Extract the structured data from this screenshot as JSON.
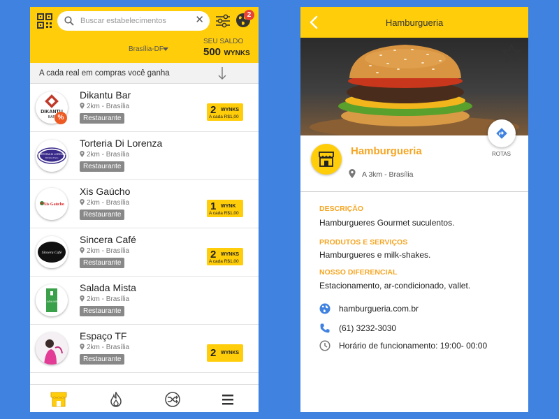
{
  "colors": {
    "background": "#3f82e0",
    "accent": "#ffcd0a",
    "highlight_text": "#f5a623",
    "badge": "#e84135",
    "category_tag": "#888888"
  },
  "list_screen": {
    "search": {
      "placeholder": "Buscar estabelecimentos",
      "clear_icon": "close-icon"
    },
    "notifications_count": "2",
    "region": "Brasília-DF",
    "saldo": {
      "label": "SEU SALDO",
      "value": "500",
      "unit": "WYNKS"
    },
    "info_text": "A cada real em compras você ganha",
    "establishments": [
      {
        "name": "Dikantu Bar",
        "distance": "2km - Brasília",
        "category": "Restaurante",
        "promo": "%",
        "wynks": "2",
        "wynks_unit": "WYNKS",
        "wynks_sub": "A cada R$1,00"
      },
      {
        "name": "Torteria Di Lorenza",
        "distance": "2km - Brasília",
        "category": "Restaurante"
      },
      {
        "name": "Xis Gaúcho",
        "distance": "2km - Brasília",
        "category": "Restaurante",
        "wynks": "1",
        "wynks_unit": "WYNK",
        "wynks_sub": "A cada R$1,00"
      },
      {
        "name": "Sincera Café",
        "distance": "2km - Brasília",
        "category": "Restaurante",
        "wynks": "2",
        "wynks_unit": "WYNKS",
        "wynks_sub": "A cada R$1,00"
      },
      {
        "name": "Salada Mista",
        "distance": "2km - Brasília",
        "category": "Restaurante"
      },
      {
        "name": "Espaço TF",
        "distance": "2km - Brasília",
        "category": "Restaurante",
        "wynks": "2",
        "wynks_unit": "WYNKS"
      }
    ],
    "logo_texts": {
      "dikantu": "DIKANTU",
      "dikantu_sub": "BAR",
      "torteria": "TORTERIA DI LORENZA",
      "torteria_sub": "Di Dolce Forno",
      "xis": "Xis Gaúcho",
      "sincera": "Sincera Café",
      "salada": "SALADA MISTA"
    },
    "nav": [
      "store-icon",
      "flame-icon",
      "shuffle-icon",
      "menu-icon"
    ]
  },
  "detail_screen": {
    "title": "Hamburgueria",
    "name": "Hamburgueria",
    "location": "A 3km - Brasília",
    "route_label": "ROTAS",
    "sections": [
      {
        "heading": "DESCRIÇÃO",
        "text": "Hamburgueres Gourmet suculentos."
      },
      {
        "heading": "PRODUTOS E SERVIÇOS",
        "text": "Hamburgueres e milk-shakes."
      },
      {
        "heading": "NOSSO DIFERENCIAL",
        "text": "Estacionamento, ar-condicionado, vallet."
      }
    ],
    "contacts": [
      {
        "icon": "globe-icon",
        "text": "hamburgueria.com.br"
      },
      {
        "icon": "phone-icon",
        "text": "(61) 3232-3030"
      },
      {
        "icon": "clock-icon",
        "text": "Horário de funcionamento: 19:00- 00:00"
      }
    ]
  }
}
